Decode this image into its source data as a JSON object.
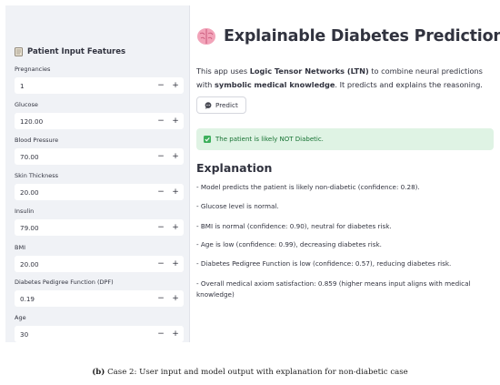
{
  "sidebar": {
    "header": "Patient Input Features",
    "fields": [
      {
        "label": "Pregnancies",
        "value": "1"
      },
      {
        "label": "Glucose",
        "value": "120.00"
      },
      {
        "label": "Blood Pressure",
        "value": "70.00"
      },
      {
        "label": "Skin Thickness",
        "value": "20.00"
      },
      {
        "label": "Insulin",
        "value": "79.00"
      },
      {
        "label": "BMI",
        "value": "20.00"
      },
      {
        "label": "Diabetes Pedigree Function (DPF)",
        "value": "0.19"
      },
      {
        "label": "Age",
        "value": "30"
      }
    ],
    "minus_label": "−",
    "plus_label": "+"
  },
  "main": {
    "title": "Explainable Diabetes Prediction",
    "intro_part1": "This app uses ",
    "intro_bold1": "Logic Tensor Networks (LTN)",
    "intro_part2": " to combine neural predictions with ",
    "intro_bold2": "symbolic medical knowledge",
    "intro_part3": ". It predicts and explains the reasoning.",
    "predict_button": "Predict",
    "success_message": "The patient is likely NOT Diabetic.",
    "explanation_heading": "Explanation",
    "explanation_items": [
      "- Model predicts the patient is likely non-diabetic (confidence: 0.28).",
      "- Glucose level is normal.",
      "- BMI is normal (confidence: 0.90), neutral for diabetes risk.",
      "- Age is low (confidence: 0.99), decreasing diabetes risk.",
      "- Diabetes Pedigree Function is low (confidence: 0.57), reducing diabetes risk.",
      "- Overall medical axiom satisfaction: 0.859 (higher means input aligns with medical knowledge)"
    ]
  },
  "caption": {
    "label": "(b)",
    "text": " Case 2: User input and model output with explanation for non-diabetic case"
  },
  "colors": {
    "sidebar_bg": "#f0f2f6",
    "success_bg": "#dff3e4",
    "success_text": "#177233",
    "brain": "#e8799a"
  }
}
